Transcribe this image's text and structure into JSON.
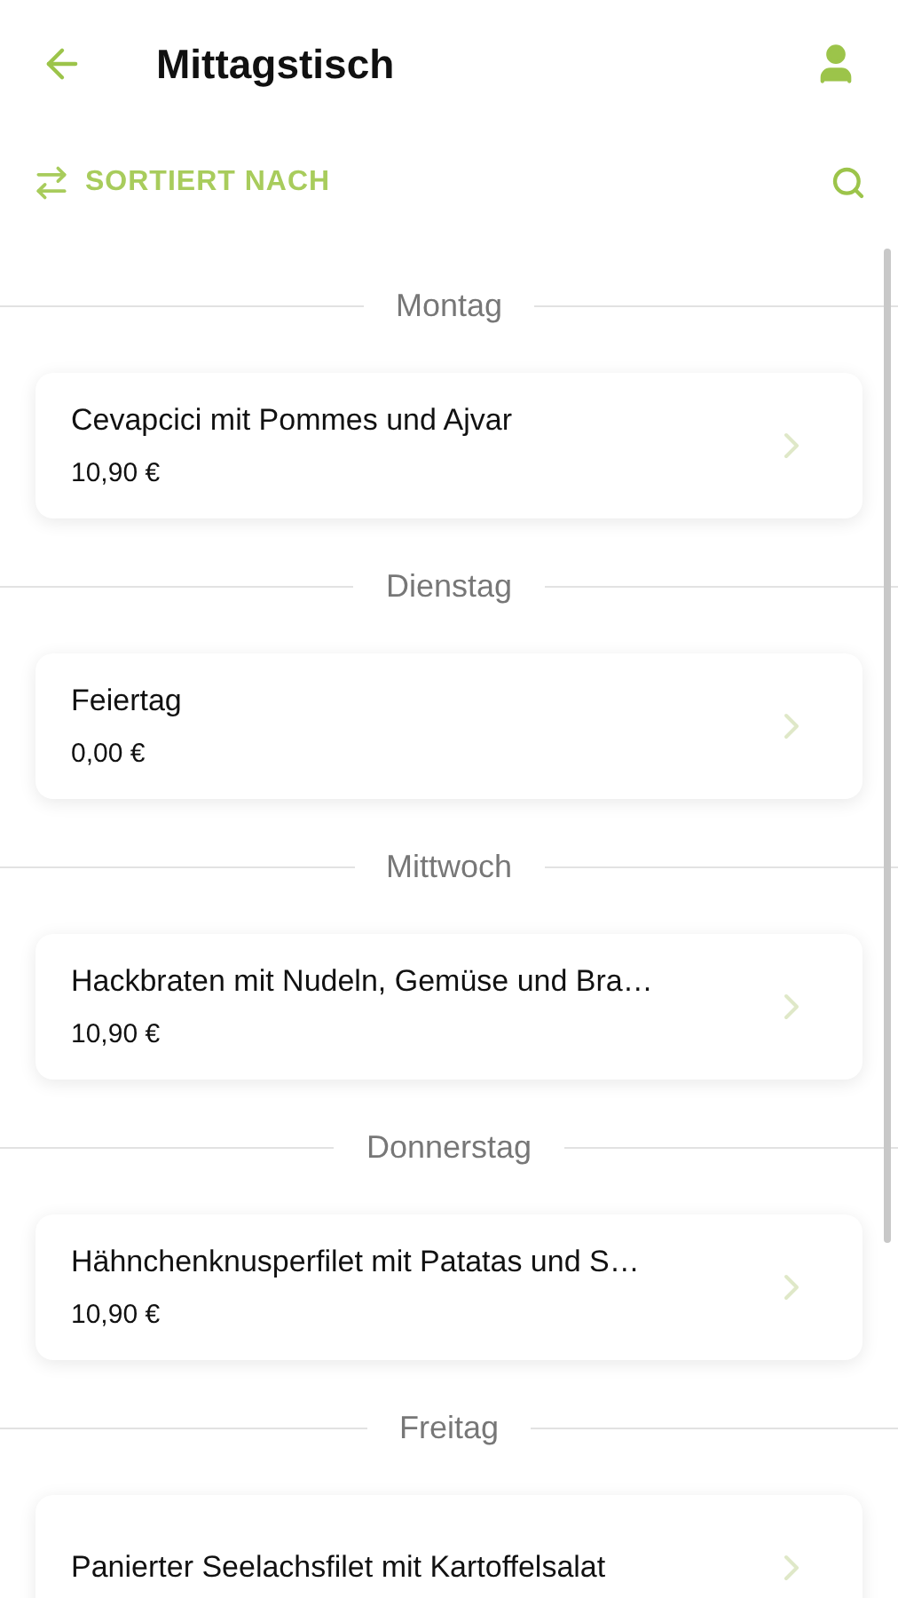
{
  "header": {
    "title": "Mittagstisch"
  },
  "toolbar": {
    "sort_label": "SORTIERT NACH"
  },
  "days": [
    {
      "day": "Montag",
      "dish": "Cevapcici mit Pommes und Ajvar",
      "price": "10,90 €"
    },
    {
      "day": "Dienstag",
      "dish": "Feiertag",
      "price": "0,00 €"
    },
    {
      "day": "Mittwoch",
      "dish": "Hackbraten mit Nudeln, Gemüse und Bra…",
      "price": "10,90 €"
    },
    {
      "day": "Donnerstag",
      "dish": "Hähnchenknusperfilet mit Patatas und S…",
      "price": "10,90 €"
    },
    {
      "day": "Freitag",
      "dish": "Panierter Seelachsfilet mit Kartoffelsalat"
    }
  ]
}
